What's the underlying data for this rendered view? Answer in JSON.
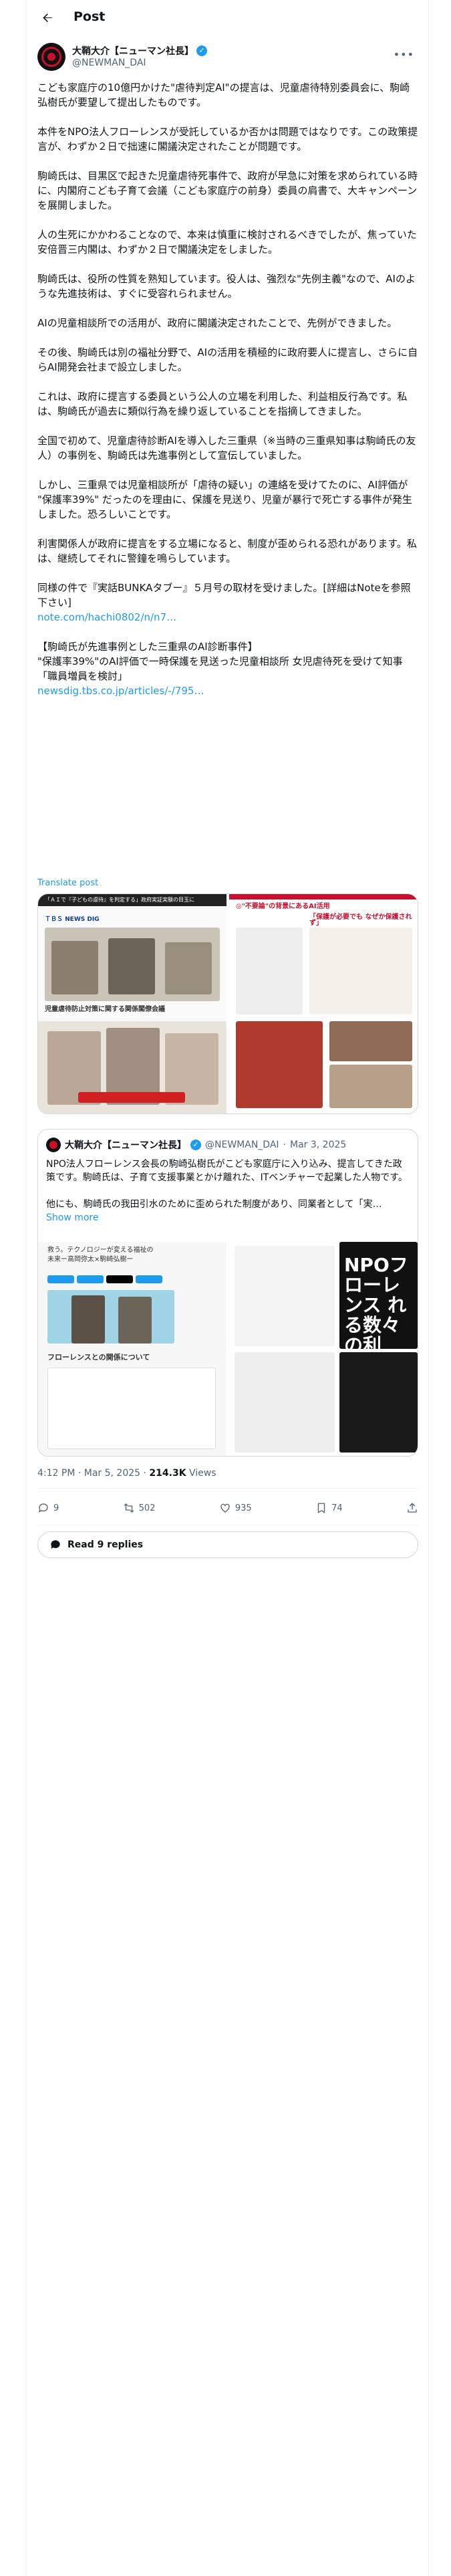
{
  "header": {
    "title": "Post"
  },
  "author": {
    "name": "大鞘大介【ニューマン社長】",
    "handle": "@NEWMAN_DAI"
  },
  "post": {
    "text": "こども家庭庁の10億円かけた\"虐待判定AI\"の提言は、児童虐待特別委員会に、駒崎弘樹氏が要望して提出したものです。\n\n本件をNPO法人フローレンスが受託しているか否かは問題ではなりです。この政策提言が、わずか２日で拙速に閣議決定されたことが問題です。\n\n駒崎氏は、目黒区で起きた児童虐待死事件で、政府が早急に対策を求められている時に、内閣府こども子育て会議（こども家庭庁の前身）委員の肩書で、大キャンペーンを展開しました。\n\n人の生死にかかわることなので、本来は慎重に検討されるべきでしたが、焦っていた安倍晋三内閣は、わずか２日で閣議決定をしました。\n\n駒崎氏は、役所の性質を熟知しています。役人は、強烈な\"先例主義\"なので、AIのような先進技術は、すぐに受容れられません。\n\nAIの児童相談所での活用が、政府に閣議決定されたことで、先例ができました。\n\nその後、駒崎氏は別の福祉分野で、AIの活用を積極的に政府要人に提言し、さらに自らAI開発会社まで設立しました。\n\nこれは、政府に提言する委員という公人の立場を利用した、利益相反行為です。私は、駒崎氏が過去に類似行為を繰り返していることを指摘してきました。\n\n全国で初めて、児童虐待診断AIを導入した三重県（※当時の三重県知事は駒崎氏の友人）の事例を、駒崎氏は先進事例として宣伝していました。\n\nしかし、三重県では児童相談所が「虐待の疑い」の連絡を受けてたのに、AI評価が \"保護率39%\" だったのを理由に、保護を見送り、児童が暴行で死亡する事件が発生しました。恐ろしいことです。\n\n利害関係人が政府に提言をする立場になると、制度が歪められる恐れがあります。私は、継続してそれに警鐘を鳴らしています。\n\n同様の件で『実話BUNKAタブー』５月号の取材を受けました。[詳細はNoteを参照下さい]\n",
    "link1": "note.com/hachi0802/n/n7…",
    "text2": "\n\n【駒崎氏が先進事例とした三重県のAI診断事件】\n\"保護率39%\"のAI評価で一時保護を見送った児童相談所 女児虐待死を受けて知事「職員増員を検討」\n",
    "link2": "newsdig.tbs.co.jp/articles/-/795…",
    "translate": "Translate post",
    "media_left": {
      "outlet": "ＴＢＳ NEWS DIG",
      "caption": "「ＡＩで『子どもの虐待』を判定する」政府実証実験の目玉に",
      "subtitle": "児童虐待防止対策に関する関係閣僚会議"
    },
    "media_right": {
      "headline": "◎\"不要論\"の背景にあるAI活用",
      "caption": "「保護が必要でも なぜか保護されず」"
    }
  },
  "quote": {
    "name": "大鞘大介【ニューマン社長】",
    "handle": "@NEWMAN_DAI",
    "date": "Mar 3, 2025",
    "text": "NPO法人フローレンス会長の駒崎弘樹氏がこども家庭庁に入り込み、提言してきた政策です。駒崎氏は、子育て支援事業とかけ離れた、ITベンチャーで起業した人物です。\n\n他にも、駒崎氏の我田引水のために歪められた制度があり、同業者として「実…",
    "show_more": "Show more",
    "media_left": {
      "heading": "フローレンスとの関係について",
      "line1": "救う。テクノロジーが変える福祉の",
      "line2": "未来ー高岡弥太×駒崎弘樹ー"
    },
    "media_right": {
      "headline": "NPOフローレンス れる数々の利"
    }
  },
  "meta": {
    "time": "4:12 PM · Mar 5, 2025 · ",
    "views": "214.3K",
    "views_label": " Views"
  },
  "actions": {
    "replies": "9",
    "reposts": "502",
    "likes": "935",
    "bookmarks": "74"
  },
  "read_replies": "Read 9 replies"
}
